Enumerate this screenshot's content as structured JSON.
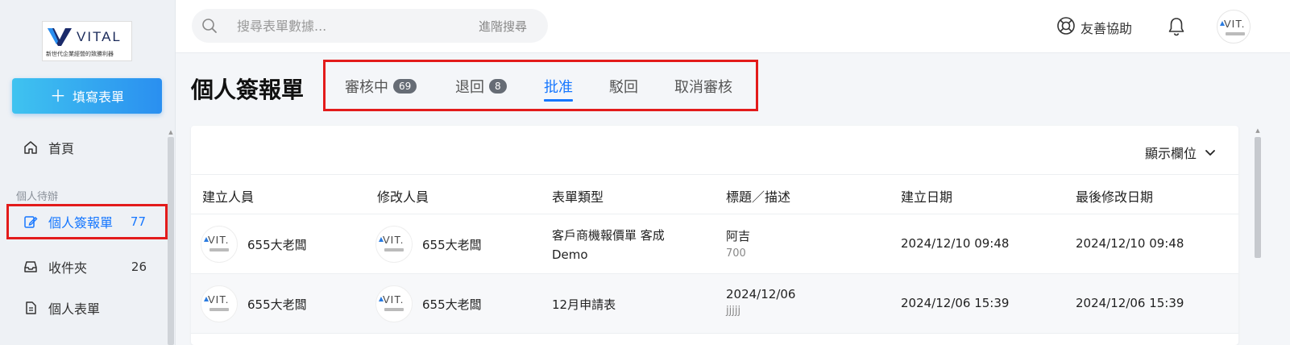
{
  "brand": {
    "name": "VITAL",
    "tagline": "新世代企業經營的致勝利器",
    "colors": {
      "accent": "#1677ff",
      "highlight": "#e31b1b",
      "button_start": "#3fc3f0",
      "button_end": "#2a8ff0"
    }
  },
  "sidebar": {
    "fill_form_label": "填寫表單",
    "home_label": "首頁",
    "section_label": "個人待辦",
    "items": [
      {
        "label": "個人簽報單",
        "count": "77",
        "icon": "form-edit-icon",
        "active": true
      },
      {
        "label": "收件夾",
        "count": "26",
        "icon": "inbox-icon",
        "active": false
      },
      {
        "label": "個人表單",
        "count": "",
        "icon": "document-icon",
        "active": false
      }
    ]
  },
  "header": {
    "search_placeholder": "搜尋表單數據...",
    "advanced_search": "進階搜尋",
    "help_label": "友善協助",
    "avatar_text": "VIT."
  },
  "page": {
    "title": "個人簽報單",
    "tabs": [
      {
        "label": "審核中",
        "badge": "69",
        "active": false
      },
      {
        "label": "退回",
        "badge": "8",
        "active": false
      },
      {
        "label": "批准",
        "badge": "",
        "active": true
      },
      {
        "label": "駁回",
        "badge": "",
        "active": false
      },
      {
        "label": "取消審核",
        "badge": "",
        "active": false
      }
    ]
  },
  "table": {
    "show_columns_label": "顯示欄位",
    "headers": [
      "建立人員",
      "修改人員",
      "表單類型",
      "標題／描述",
      "建立日期",
      "最後修改日期"
    ],
    "avatar_text": "VIT.",
    "rows": [
      {
        "creator": "655大老闆",
        "modifier": "655大老闆",
        "form_type": "客戶商機報價單 客成",
        "form_type_line2": "Demo",
        "title": "阿吉",
        "description": "700",
        "created": "2024/12/10 09:48",
        "modified": "2024/12/10 09:48"
      },
      {
        "creator": "655大老闆",
        "modifier": "655大老闆",
        "form_type": "12月申請表",
        "form_type_line2": "",
        "title": "2024/12/06",
        "description": "jjjjj",
        "created": "2024/12/06 15:39",
        "modified": "2024/12/06 15:39"
      }
    ]
  }
}
